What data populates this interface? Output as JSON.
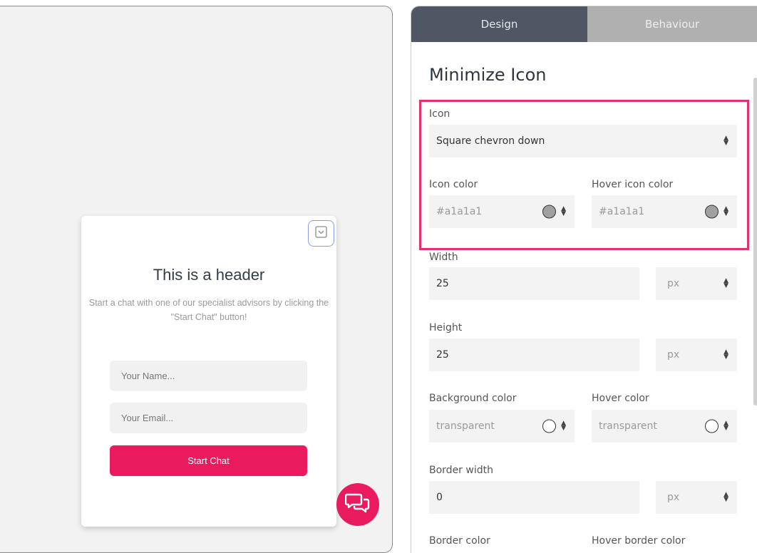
{
  "preview": {
    "widget": {
      "header": "This is a header",
      "subtitle": "Start a chat with one of our specialist advisors by clicking the \"Start Chat\" button!",
      "name_placeholder": "Your Name...",
      "email_placeholder": "Your Email...",
      "start_button": "Start Chat",
      "minimize_icon": "square-chevron-down-icon"
    },
    "fab_icon": "chat-bubbles-icon",
    "accent_color": "#ea1a5f"
  },
  "panel": {
    "tabs": [
      {
        "label": "Design",
        "active": true
      },
      {
        "label": "Behaviour",
        "active": false
      }
    ],
    "section_title": "Minimize Icon",
    "icon": {
      "label": "Icon",
      "value": "Square chevron down"
    },
    "icon_color": {
      "label": "Icon color",
      "value": "#a1a1a1",
      "swatch": "#a1a1a1"
    },
    "hover_icon_color": {
      "label": "Hover icon color",
      "value": "#a1a1a1",
      "swatch": "#a1a1a1"
    },
    "width": {
      "label": "Width",
      "value": "25",
      "unit": "px"
    },
    "height": {
      "label": "Height",
      "value": "25",
      "unit": "px"
    },
    "background_color": {
      "label": "Background color",
      "value": "transparent"
    },
    "hover_color": {
      "label": "Hover color",
      "value": "transparent"
    },
    "border_width": {
      "label": "Border width",
      "value": "0",
      "unit": "px"
    },
    "border_color": {
      "label": "Border color"
    },
    "hover_border_color": {
      "label": "Hover border color"
    },
    "highlight_color": "#e2326e"
  }
}
